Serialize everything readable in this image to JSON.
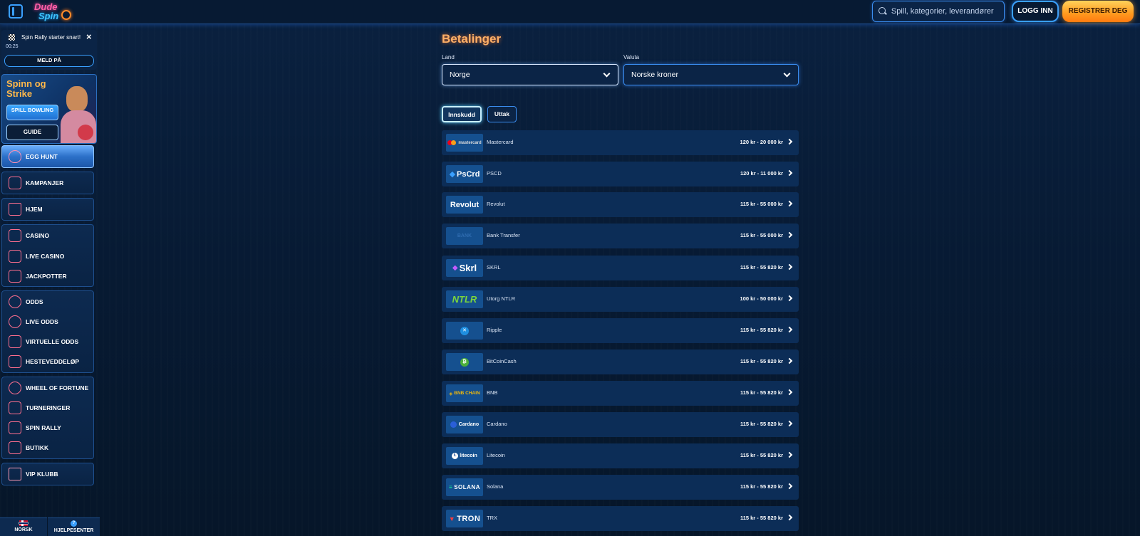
{
  "header": {
    "brand_top": "Dude",
    "brand_bottom": "Spin",
    "search_placeholder": "Spill, kategorier, leverandører",
    "login_label": "LOGG INN",
    "register_label": "REGISTRER DEG"
  },
  "rally_notice": {
    "title": "Spin Rally starter snart!",
    "timer": "00:25",
    "join_label": "MELD PÅ"
  },
  "promo": {
    "title": "Spinn og Strike",
    "play_label": "SPILL BOWLING",
    "guide_label": "GUIDE"
  },
  "nav": {
    "egg_hunt": "EGG HUNT",
    "campaigns": "KAMPANJER",
    "home": "HJEM",
    "casino": "CASINO",
    "live_casino": "LIVE CASINO",
    "jackpots": "JACKPOTTER",
    "odds": "ODDS",
    "live_odds": "LIVE ODDS",
    "virtual_odds": "VIRTUELLE ODDS",
    "horse_racing": "HESTEVEDDELØP",
    "wheel_of_fortune": "WHEEL OF FORTUNE",
    "tournaments": "TURNERINGER",
    "spin_rally": "SPIN RALLY",
    "shop": "BUTIKK",
    "vip_club": "VIP KLUBB"
  },
  "footer": {
    "language": "NORSK",
    "help": "HJELPESENTER"
  },
  "main": {
    "title": "Betalinger",
    "country_label": "Land",
    "country_value": "Norge",
    "currency_label": "Valuta",
    "currency_value": "Norske kroner",
    "tab_deposit": "Innskudd",
    "tab_withdraw": "Uttak"
  },
  "payments": [
    {
      "logo": "mastercard",
      "name": "Mastercard",
      "range": "120 kr - 20 000 kr"
    },
    {
      "logo": "PsCrd",
      "name": "PSCD",
      "range": "120 kr - 11 000 kr"
    },
    {
      "logo": "Revolut",
      "name": "Revolut",
      "range": "115 kr - 55 000 kr"
    },
    {
      "logo": "BANK",
      "name": "Bank Transfer",
      "range": "115 kr - 55 000 kr"
    },
    {
      "logo": "Skrl",
      "name": "SKRL",
      "range": "115 kr - 55 820 kr"
    },
    {
      "logo": "NTLR",
      "name": "Utorg NTLR",
      "range": "100 kr - 50 000 kr"
    },
    {
      "logo": "",
      "name": "Ripple",
      "range": "115 kr - 55 820 kr"
    },
    {
      "logo": "",
      "name": "BitCoinCash",
      "range": "115 kr - 55 820 kr"
    },
    {
      "logo": "BNB CHAIN",
      "name": "BNB",
      "range": "115 kr - 55 820 kr"
    },
    {
      "logo": "Cardano",
      "name": "Cardano",
      "range": "115 kr - 55 820 kr"
    },
    {
      "logo": "litecoin",
      "name": "Litecoin",
      "range": "115 kr - 55 820 kr"
    },
    {
      "logo": "SOLANA",
      "name": "Solana",
      "range": "115 kr - 55 820 kr"
    },
    {
      "logo": "TRON",
      "name": "TRX",
      "range": "115 kr - 55 820 kr"
    }
  ],
  "colors": {
    "accent": "#3aa0ff",
    "title_orange": "#ffb067",
    "register_orange": "#ff9a1f",
    "row_bg": "#0c2d57"
  }
}
